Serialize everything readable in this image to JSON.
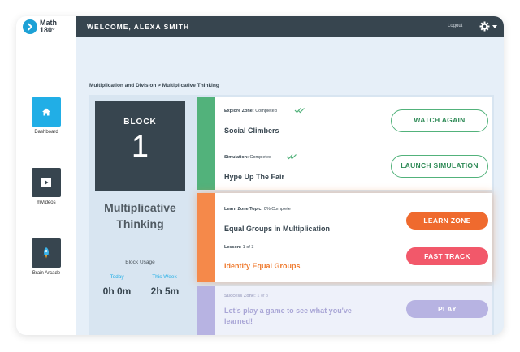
{
  "logo": {
    "line1": "Math",
    "line2": "180°"
  },
  "sidebar": {
    "items": [
      {
        "label": "Dashboard"
      },
      {
        "label": "mVideos"
      },
      {
        "label": "Brain Arcade"
      }
    ]
  },
  "header": {
    "welcome": "WELCOME, ALEXA SMITH",
    "logout": "Logout"
  },
  "breadcrumb": "Multiplication and Division > Multiplicative Thinking",
  "block": {
    "label": "BLOCK",
    "number": "1",
    "topic_line1": "Multiplicative",
    "topic_line2": "Thinking"
  },
  "usage": {
    "title": "Block Usage",
    "today_label": "Today",
    "week_label": "This Week",
    "today_value": "0h 0m",
    "week_value": "2h 5m"
  },
  "explore": {
    "zone_label": "Explore Zone:",
    "zone_status": "Completed",
    "title": "Social Climbers",
    "button": "WATCH AGAIN",
    "sim_label": "Simulation:",
    "sim_status": "Completed",
    "sim_title": "Hype Up The Fair",
    "sim_button": "LAUNCH SIMULATION"
  },
  "learn": {
    "topic_label": "Learn Zone Topic:",
    "topic_status": "0% Complete",
    "title": "Equal Groups in Multiplication",
    "button": "LEARN ZONE",
    "lesson_label": "Lesson:",
    "lesson_count": "1 of 3",
    "lesson_title": "Identify Equal Groups",
    "lesson_button": "FAST TRACK"
  },
  "success": {
    "zone_label": "Success Zone:",
    "zone_count": "1 of 3",
    "line1": "Let's play a game to see what you've",
    "line2": "learned!",
    "button": "PLAY"
  },
  "colors": {
    "accent_blue": "#21aee6",
    "dark_slate": "#37454f",
    "explore_green": "#52b27b",
    "learn_orange": "#f5894a",
    "learn_button": "#ef6a2e",
    "fast_track": "#f2586a",
    "success_lavender": "#b7b3e2",
    "lesson_title_orange": "#ef7a2e"
  }
}
